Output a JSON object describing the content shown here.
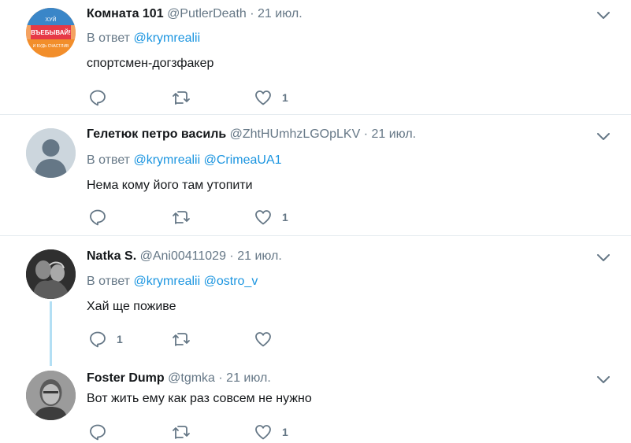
{
  "reply_prefix": "В ответ",
  "tweets": [
    {
      "name": "Комната 101",
      "handle": "@PutlerDeath",
      "dot": "·",
      "date": "21 июл.",
      "mentions": [
        "@krymrealii"
      ],
      "text": "спортсмен-догзфакер",
      "reply_count": "",
      "like_count": "1",
      "avatar_lines": [
        "ХУЙ",
        "ВЪЕБЫВАЙ!",
        "И БУДЬ СЧАСТЛИВ"
      ],
      "avatar_colors": [
        "#f4a261",
        "#e63946",
        "#3a86c8"
      ]
    },
    {
      "name": "Гелетюк петро василь",
      "handle": "@ZhtHUmhzLGOpLKV",
      "dot": "·",
      "date": "21 июл.",
      "mentions": [
        "@krymrealii",
        "@CrimeaUA1"
      ],
      "text": "Нема кому його там утопити",
      "reply_count": "",
      "like_count": "1"
    },
    {
      "name": "Natka S.",
      "handle": "@Ani00411029",
      "dot": "·",
      "date": "21 июл.",
      "mentions": [
        "@krymrealii",
        "@ostro_v"
      ],
      "text": "Хай ще поживе",
      "reply_count": "1",
      "like_count": ""
    },
    {
      "name": "Foster Dump",
      "handle": "@tgmka",
      "dot": "·",
      "date": "21 июл.",
      "mentions": [],
      "text": "Вот жить ему как раз совсем не нужно",
      "reply_count": "",
      "like_count": "1"
    }
  ],
  "colors": {
    "name": "#14171a",
    "muted": "#657786",
    "mention": "#1b95e0",
    "divider": "#e6ecf0",
    "thread_line": "#b3dff4"
  },
  "icons": [
    "reply-icon",
    "retweet-icon",
    "like-icon",
    "chevron-down-icon"
  ]
}
